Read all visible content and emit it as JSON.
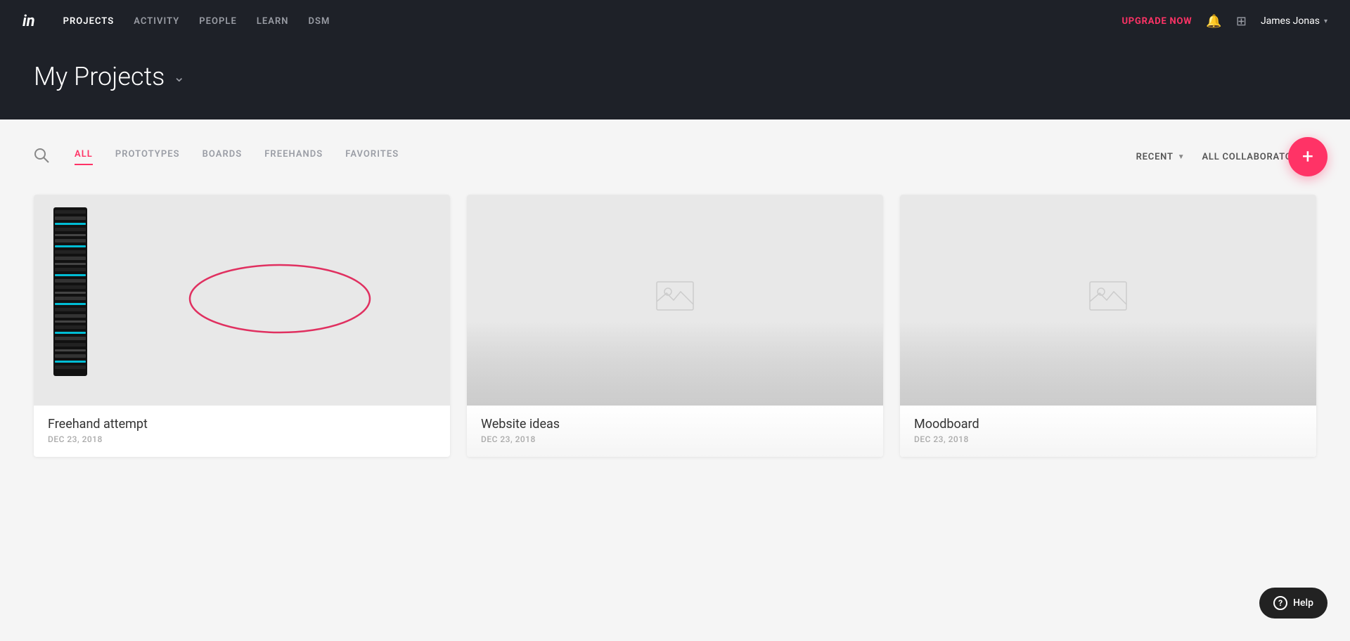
{
  "nav": {
    "logo": "in",
    "links": [
      {
        "label": "PROJECTS",
        "active": true
      },
      {
        "label": "ACTIVITY",
        "active": false
      },
      {
        "label": "PEOPLE",
        "active": false
      },
      {
        "label": "LEARN",
        "active": false
      },
      {
        "label": "DSM",
        "active": false
      }
    ],
    "upgrade_label": "UPGRADE NOW",
    "user_name": "James Jonas",
    "user_chevron": "▾"
  },
  "header": {
    "title": "My Projects",
    "chevron": "⌄"
  },
  "filters": {
    "tabs": [
      {
        "label": "ALL",
        "active": true
      },
      {
        "label": "PROTOTYPES",
        "active": false
      },
      {
        "label": "BOARDS",
        "active": false
      },
      {
        "label": "FREEHANDS",
        "active": false
      },
      {
        "label": "FAVORITES",
        "active": false
      }
    ],
    "sort_label": "RECENT",
    "collaborators_label": "ALL COLLABORATORS"
  },
  "fab": {
    "label": "+"
  },
  "projects": [
    {
      "title": "Freehand attempt",
      "date": "DEC 23, 2018",
      "has_thumbnail": true,
      "has_oval": true
    },
    {
      "title": "Website ideas",
      "date": "DEC 23, 2018",
      "has_thumbnail": false,
      "has_oval": false
    },
    {
      "title": "Moodboard",
      "date": "DEC 23, 2018",
      "has_thumbnail": false,
      "has_oval": false
    }
  ],
  "help": {
    "label": "Help"
  }
}
